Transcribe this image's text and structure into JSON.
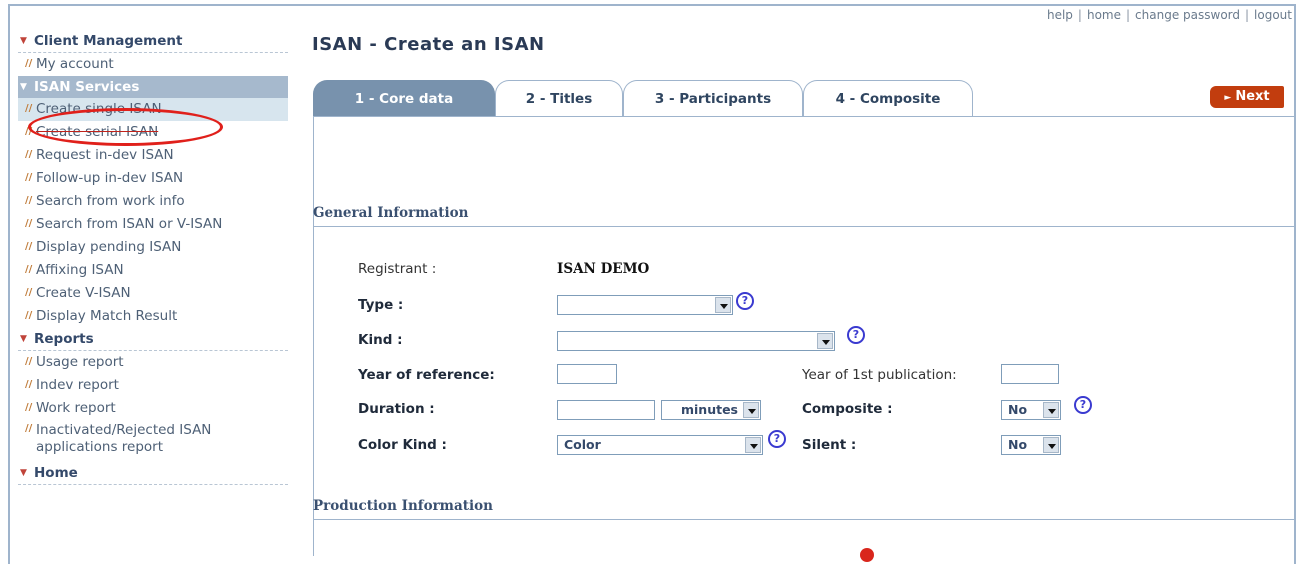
{
  "top_links": [
    "help",
    "home",
    "change password",
    "logout"
  ],
  "sidebar": {
    "sections": [
      {
        "title": "Client Management",
        "items": [
          "My account"
        ]
      },
      {
        "title": "ISAN Services",
        "items": [
          "Create single ISAN",
          "Create serial ISAN",
          "Request in-dev ISAN",
          "Follow-up in-dev ISAN",
          "Search from work info",
          "Search from ISAN or V-ISAN",
          "Display pending ISAN",
          "Affixing ISAN",
          "Create V-ISAN",
          "Display Match Result"
        ]
      },
      {
        "title": "Reports",
        "items": [
          "Usage report",
          "Indev report",
          "Work report",
          "Inactivated/Rejected ISAN applications report"
        ]
      },
      {
        "title": "Home",
        "items": []
      }
    ]
  },
  "main": {
    "title": "ISAN - Create an ISAN",
    "tabs": [
      "1 - Core data",
      "2 - Titles",
      "3 - Participants",
      "4 - Composite"
    ],
    "active_tab": 0,
    "next_label": "Next"
  },
  "general": {
    "section_title": "General Information",
    "registrant_label": "Registrant :",
    "registrant_value": "ISAN DEMO",
    "type_label": "Type :",
    "type_value": "",
    "kind_label": "Kind :",
    "kind_value": "",
    "year_ref_label": "Year of reference:",
    "year_ref_value": "",
    "year_pub_label": "Year of 1st publication:",
    "year_pub_value": "",
    "duration_label": "Duration :",
    "duration_value": "",
    "duration_unit": "minutes",
    "composite_label": "Composite :",
    "composite_value": "No",
    "color_kind_label": "Color Kind :",
    "color_kind_value": "Color",
    "silent_label": "Silent :",
    "silent_value": "No"
  },
  "production": {
    "section_title": "Production Information"
  },
  "colors": {
    "accent": "#7892ad",
    "next": "#c23d0e",
    "highlight": "#e0201b"
  }
}
